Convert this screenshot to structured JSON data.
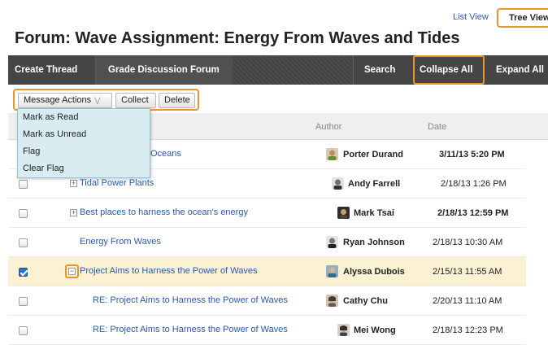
{
  "view_switch": {
    "list_view": "List View",
    "tree_view": "Tree View"
  },
  "page_title": "Forum: Wave Assignment: Energy From Waves and Tides",
  "action_bar": {
    "create_thread": "Create Thread",
    "grade_forum": "Grade Discussion Forum",
    "search": "Search",
    "collapse_all": "Collapse All",
    "expand_all": "Expand All"
  },
  "toolbar": {
    "message_actions": "Message Actions",
    "collect": "Collect",
    "delete": "Delete"
  },
  "dropdown": {
    "items": [
      "Mark as Read",
      "Mark as Unread",
      "Flag",
      "Clear Flag"
    ]
  },
  "table": {
    "columns": {
      "author": "Author",
      "date": "Date"
    },
    "rows": [
      {
        "subject": "Oceans",
        "author": "Porter Durand",
        "date": "3/11/13 5:20 PM",
        "bold_date": true,
        "checked": false,
        "toggle": "",
        "avatar_color": "#b88f6a"
      },
      {
        "subject": "Tidal Power Plants",
        "author": "Andy Farrell",
        "date": "2/18/13 1:26 PM",
        "bold_date": false,
        "checked": false,
        "toggle": "+",
        "avatar_color": "#6f6f6f"
      },
      {
        "subject": "Best places to harness the ocean's energy",
        "author": "Mark Tsai",
        "date": "2/18/13 12:59 PM",
        "bold_date": true,
        "checked": false,
        "toggle": "+",
        "avatar_color": "#5a4030"
      },
      {
        "subject": "Energy From Waves",
        "author": "Ryan Johnson",
        "date": "2/18/13 10:30 AM",
        "bold_date": false,
        "checked": false,
        "toggle": "",
        "avatar_color": "#777777"
      },
      {
        "subject": "Project Aims to Harness the Power of Waves",
        "author": "Alyssa Dubois",
        "date": "2/15/13 11:55 AM",
        "bold_date": false,
        "checked": true,
        "toggle": "−",
        "avatar_color": "#3d6b7e"
      },
      {
        "subject": "RE: Project Aims to Harness the Power of Waves",
        "author": "Cathy Chu",
        "date": "2/20/13 11:10 AM",
        "bold_date": false,
        "checked": false,
        "toggle": "",
        "avatar_color": "#4a3a2c"
      },
      {
        "subject": "RE: Project Aims to Harness the Power of Waves",
        "author": "Mei Wong",
        "date": "2/18/13 12:23 PM",
        "bold_date": false,
        "checked": false,
        "toggle": "",
        "avatar_color": "#3a2e28"
      }
    ]
  }
}
